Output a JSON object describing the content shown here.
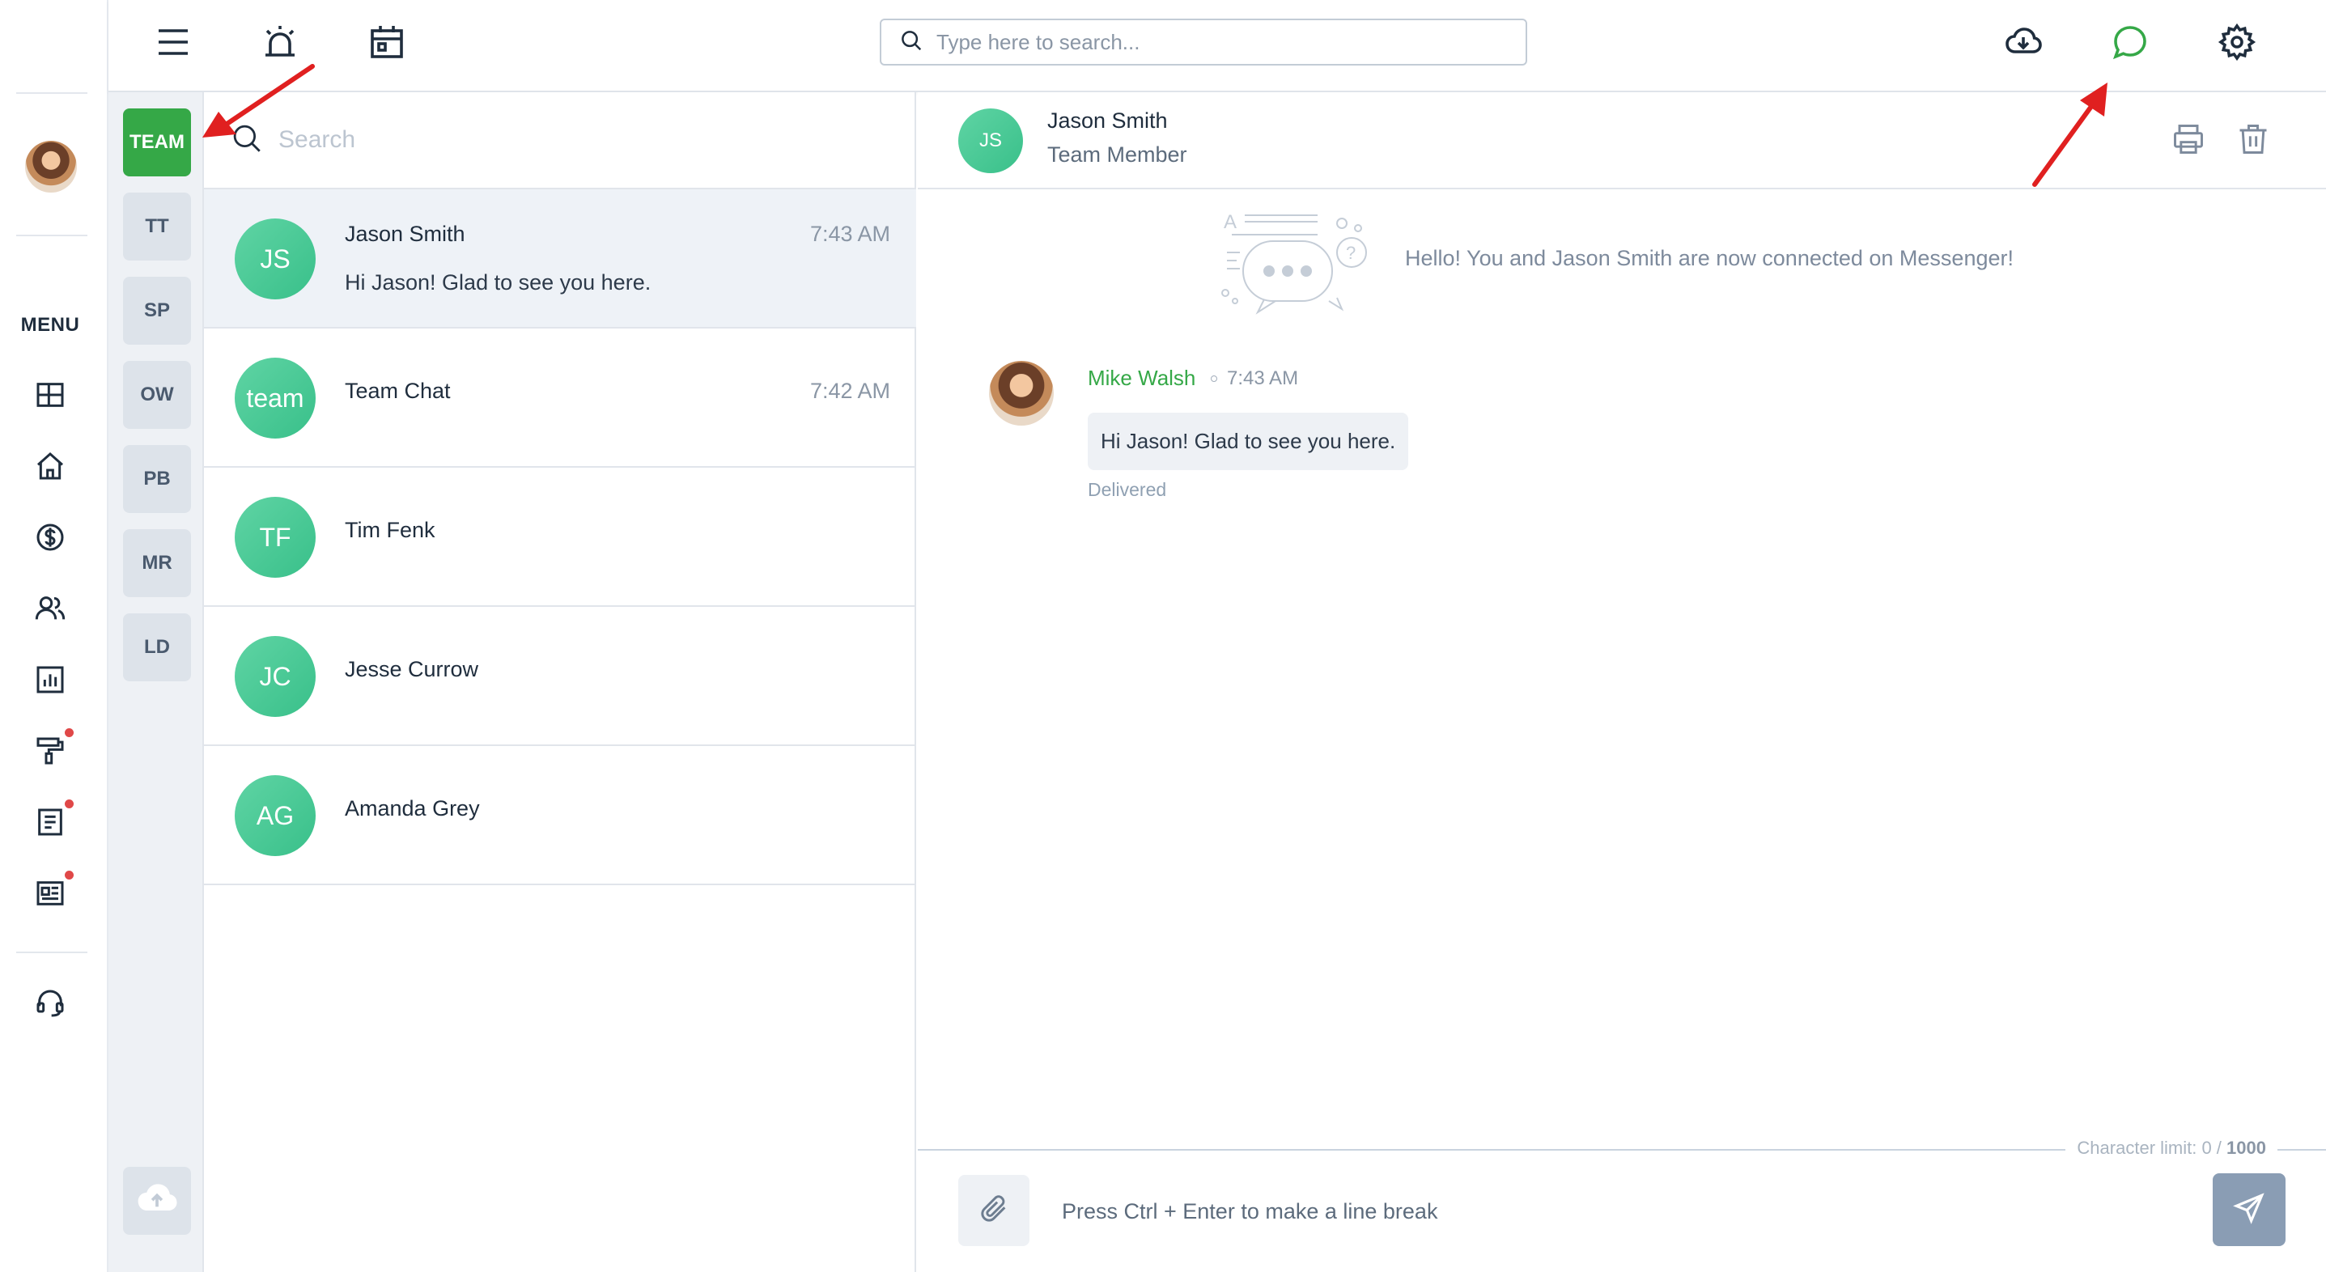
{
  "topbar": {
    "search_placeholder": "Type here to search...",
    "icons": [
      "menu-icon",
      "alarm-icon",
      "calendar-icon",
      "cloud-download-icon",
      "chat-icon",
      "gear-icon"
    ],
    "active_icon_color": "#35a847"
  },
  "leftnav": {
    "menu_label": "MENU",
    "items": [
      "dashboard-icon",
      "home-icon",
      "dollar-icon",
      "users-icon",
      "reports-icon",
      "paint-roller-icon",
      "document-icon",
      "news-icon",
      "headset-icon"
    ],
    "notification_color": "#e04848"
  },
  "groups": {
    "items": [
      {
        "label": "TEAM",
        "active": true
      },
      {
        "label": "TT"
      },
      {
        "label": "SP"
      },
      {
        "label": "OW"
      },
      {
        "label": "PB"
      },
      {
        "label": "MR"
      },
      {
        "label": "LD"
      }
    ]
  },
  "chatlist": {
    "search_placeholder": "Search",
    "chats": [
      {
        "initials": "JS",
        "name": "Jason Smith",
        "time": "7:43 AM",
        "preview": "Hi Jason! Glad to see you here."
      },
      {
        "initials": "team",
        "name": "Team Chat",
        "time": "7:42 AM",
        "preview": ""
      },
      {
        "initials": "TF",
        "name": "Tim Fenk",
        "time": "",
        "preview": ""
      },
      {
        "initials": "JC",
        "name": "Jesse Currow",
        "time": "",
        "preview": ""
      },
      {
        "initials": "AG",
        "name": "Amanda Grey",
        "time": "",
        "preview": ""
      }
    ]
  },
  "conversation": {
    "header": {
      "initials": "JS",
      "name": "Jason Smith",
      "role": "Team Member"
    },
    "connected_text": "Hello! You and Jason Smith are now connected on Messenger!",
    "message": {
      "sender": "Mike Walsh",
      "time": "7:43 AM",
      "text": "Hi Jason! Glad to see you here.",
      "status": "Delivered"
    },
    "composer": {
      "char_limit_label": "Character limit: 0 /",
      "char_limit_max": "1000",
      "placeholder": "Press Ctrl + Enter to make a line break"
    }
  },
  "colors": {
    "accent": "#35a847",
    "avatar": "#4cca98",
    "send": "#8a9db4"
  }
}
